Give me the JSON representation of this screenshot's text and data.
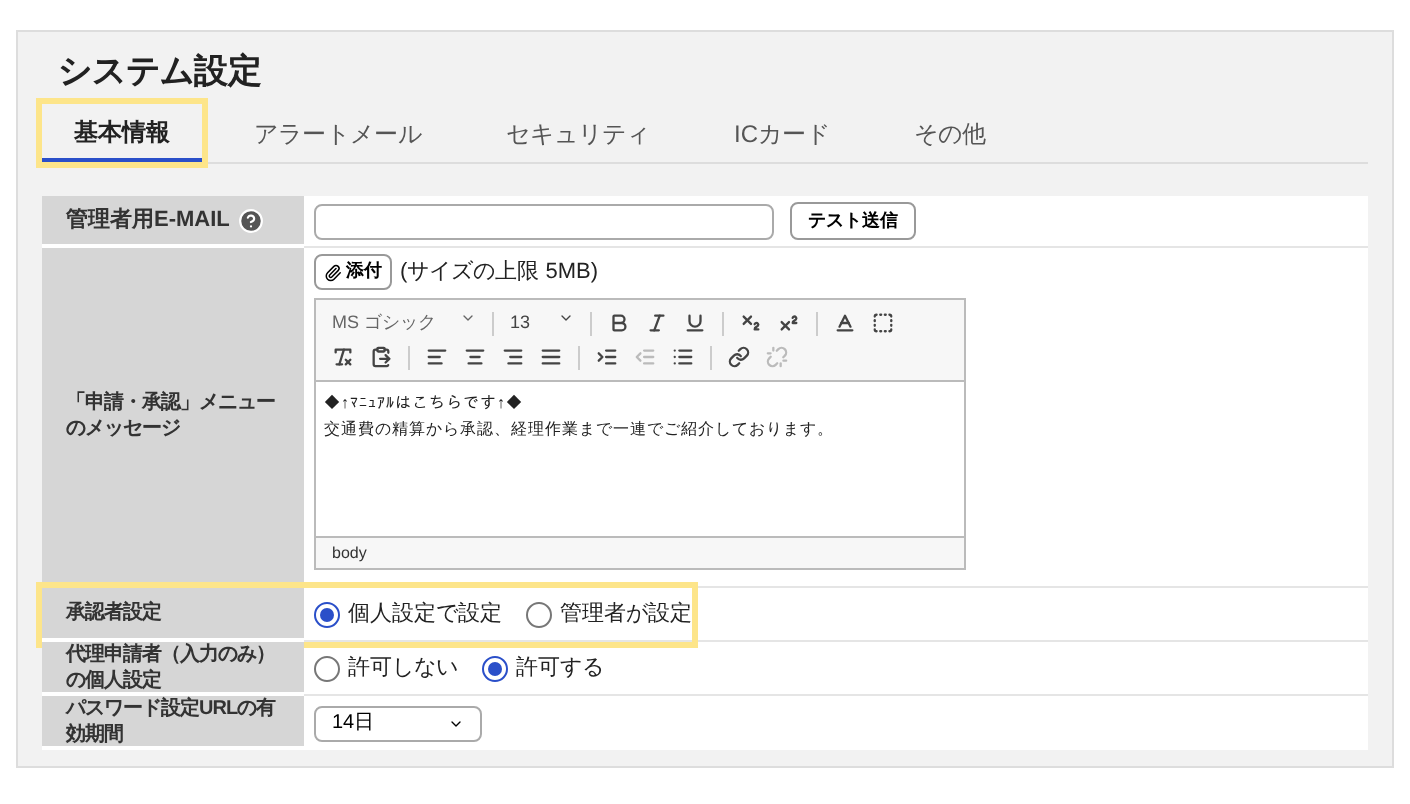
{
  "title": "システム設定",
  "tabs": [
    {
      "label": "基本情報",
      "selected": true,
      "highlighted": true
    },
    {
      "label": "アラートメール",
      "selected": false,
      "highlighted": false
    },
    {
      "label": "セキュリティ",
      "selected": false,
      "highlighted": false
    },
    {
      "label": "ICカード",
      "selected": false,
      "highlighted": false
    },
    {
      "label": "その他",
      "selected": false,
      "highlighted": false
    }
  ],
  "email": {
    "label": "管理者用E-MAIL",
    "button": "テスト送信"
  },
  "message": {
    "label": "「申請・承認」メニューのメッセージ",
    "attach_button": "添付",
    "attach_note": "(サイズの上限 5MB)",
    "font": "MS ゴシック",
    "size": "13",
    "lines": [
      "◆↑ﾏﾆｭｱﾙはこちらです↑◆",
      "交通費の精算から承認、経理作業まで一連でご紹介しております。"
    ],
    "footer": "body"
  },
  "radio_rows": [
    {
      "label": "承認者設定",
      "highlighted": true,
      "options": [
        {
          "label": "個人設定で設定",
          "selected": true
        },
        {
          "label": "管理者が設定",
          "selected": false
        }
      ]
    },
    {
      "label": "代理申請者（入力のみ）の個人設定",
      "highlighted": false,
      "options": [
        {
          "label": "許可しない",
          "selected": false
        },
        {
          "label": "許可する",
          "selected": true
        }
      ]
    }
  ],
  "password_url": {
    "label": "パスワード設定URLの有効期間",
    "value": "14日"
  }
}
